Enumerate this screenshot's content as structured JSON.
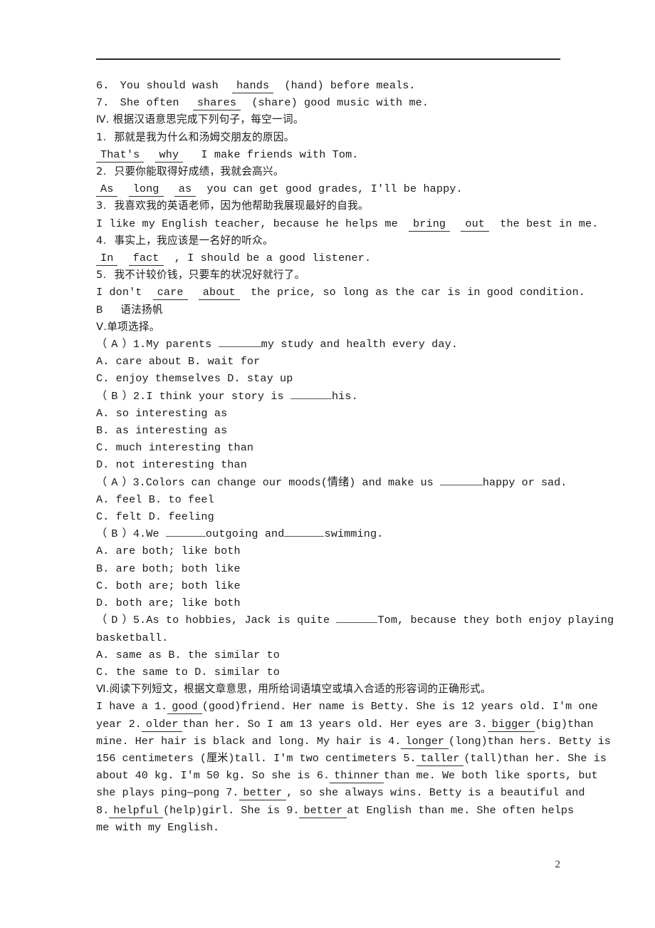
{
  "page": {
    "number": "2"
  },
  "section_fill_tail": {
    "q6": {
      "num": "6.",
      "before": "You should wash",
      "answer": "hands",
      "after": "(hand) before meals."
    },
    "q7": {
      "num": "7.",
      "before": "She often",
      "answer": "shares",
      "after": "(share) good music with me."
    }
  },
  "section_iv": {
    "heading": "Ⅳ. 根据汉语意思完成下列句子，每空一词。",
    "items": [
      {
        "num": "1.",
        "chinese": "那就是我为什么和汤姆交朋友的原因。",
        "answers": [
          "That's",
          "why"
        ],
        "tail": "I make friends with Tom."
      },
      {
        "num": "2.",
        "chinese": "只要你能取得好成绩，我就会高兴。",
        "answers": [
          "As",
          "long",
          "as"
        ],
        "tail": "you can get good grades, I'll be happy."
      },
      {
        "num": "3.",
        "chinese": "我喜欢我的英语老师，因为他帮助我展现最好的自我。",
        "lead": "I like my English teacher, because he helps me",
        "answers": [
          "bring",
          "out"
        ],
        "tail": "the best in me."
      },
      {
        "num": "4.",
        "chinese": "事实上，我应该是一名好的听众。",
        "answers": [
          "In",
          "fact"
        ],
        "tail": ", I should be a good listener."
      },
      {
        "num": "5.",
        "chinese": "我不计较价钱，只要车的状况好就行了。",
        "lead": "I don't",
        "answers": [
          "care",
          "about"
        ],
        "tail": "the price, so long as the car is in good condition."
      }
    ]
  },
  "part_b": {
    "label": "B",
    "title": "语法扬帆"
  },
  "section_v": {
    "heading": "Ⅴ.单项选择。",
    "questions": [
      {
        "answer": "A",
        "num": "1.",
        "stem_before": "My parents",
        "stem_after": "my study and health every day.",
        "options_lines": [
          "A. care about        B. wait for",
          "C. enjoy themselves  D. stay up"
        ]
      },
      {
        "answer": "B",
        "num": "2.",
        "stem_before": "I think your story is",
        "stem_after": "his.",
        "options_lines": [
          "A. so interesting as",
          "B. as interesting as",
          "C. much interesting than",
          "D. not interesting than"
        ]
      },
      {
        "answer": "A",
        "num": "3.",
        "stem_before": "Colors can change our moods(情绪) and make us",
        "stem_after": "happy or sad.",
        "options_lines": [
          "A. feel  B. to feel",
          "C. felt  D. feeling"
        ]
      },
      {
        "answer": "B",
        "num": "4.",
        "stem_before": "We",
        "stem_mid": "outgoing and",
        "stem_after": "swimming.",
        "options_lines": [
          "A. are both; like both",
          "B. are both; both like",
          "C. both are; both like",
          "D. both are; like both"
        ]
      },
      {
        "answer": "D",
        "num": "5.",
        "stem_before": "As to hobbies, Jack is quite",
        "stem_after": "Tom, because they both enjoy playing",
        "stem_wrap": "basketball.",
        "options_lines": [
          "A. same as  B. the similar to",
          "C. the same to  D. similar to"
        ]
      }
    ]
  },
  "section_vi": {
    "heading": "Ⅵ.阅读下列短文，根据文章意思，用所给词语填空或填入合适的形容词的正确形式。",
    "passage_lines": [
      [
        {
          "t": "I have a 1."
        },
        {
          "a": "good"
        },
        {
          "t": "(good)friend. Her name is Betty. She is 12 years old. I'm one"
        }
      ],
      [
        {
          "t": "year 2."
        },
        {
          "a": "older"
        },
        {
          "t": "than her. So I am 13 years old. Her eyes are 3."
        },
        {
          "a": "bigger"
        },
        {
          "t": "(big)than"
        }
      ],
      [
        {
          "t": "mine. Her hair is black and long. My hair is 4."
        },
        {
          "a": "longer"
        },
        {
          "t": "(long)than hers. Betty is"
        }
      ],
      [
        {
          "t": "156 centimeters (厘米)tall. I'm two centimeters 5."
        },
        {
          "a": "taller"
        },
        {
          "t": "(tall)than her. She is"
        }
      ],
      [
        {
          "t": "about 40 kg. I'm 50 kg. So she is 6."
        },
        {
          "a": "thinner"
        },
        {
          "t": "than me. We both like sports, but"
        }
      ],
      [
        {
          "t": "she plays ping—pong 7."
        },
        {
          "a": "better"
        },
        {
          "t": ", so she always wins. Betty is a beautiful and"
        }
      ],
      [
        {
          "t": "8."
        },
        {
          "a": "helpful"
        },
        {
          "t": "(help)girl. She is 9."
        },
        {
          "a": "better"
        },
        {
          "t": "at English than me. She often helps"
        }
      ],
      [
        {
          "t": "me with my English."
        }
      ]
    ]
  }
}
